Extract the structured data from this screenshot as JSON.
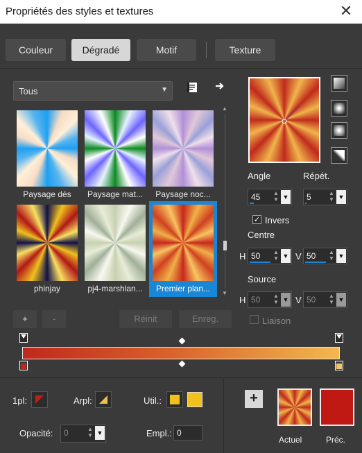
{
  "window": {
    "title": "Propriétés des styles et textures",
    "close_glyph": "✕"
  },
  "tabs": [
    {
      "label": "Couleur",
      "active": false
    },
    {
      "label": "Dégradé",
      "active": true
    },
    {
      "label": "Motif",
      "active": false
    },
    {
      "label": "Texture",
      "active": false
    }
  ],
  "category": {
    "selected": "Tous"
  },
  "icons": {
    "dropdown": "chevron-down-icon",
    "notes": "notes-icon",
    "arrow": "arrow-right-icon"
  },
  "gallery": [
    {
      "label": "Paysage dés",
      "colors": [
        "#1da0f0",
        "#f6dcc6",
        "#fff0d8",
        "#58b4f0"
      ],
      "selected": false
    },
    {
      "label": "Paysage mat...",
      "colors": [
        "#0d8a24",
        "#e6f2ff",
        "#6d64ff",
        "#ffffff"
      ],
      "selected": false
    },
    {
      "label": "Paysage noc...",
      "colors": [
        "#b090d8",
        "#e0c8d8",
        "#9aa0d8",
        "#f0e0ea"
      ],
      "selected": false
    },
    {
      "label": "phinjay",
      "colors": [
        "#12124a",
        "#f0c020",
        "#b01818",
        "#f8e060"
      ],
      "selected": false
    },
    {
      "label": "pj4-marshlan...",
      "colors": [
        "#c8d0b0",
        "#f8f8f0",
        "#a0b098",
        "#e8ecd8"
      ],
      "selected": false
    },
    {
      "label": "Premier plan...",
      "colors": [
        "#c8281c",
        "#f0b048",
        "#d04020",
        "#f7c460"
      ],
      "selected": true
    }
  ],
  "buttons": {
    "add": "+",
    "remove": "-",
    "reset": "Réinit",
    "save": "Enreg."
  },
  "preview": {
    "colors": [
      "#c02a1c",
      "#f0b44c"
    ]
  },
  "angle": {
    "label": "Angle",
    "value": "45",
    "fill": 0.125
  },
  "repeat": {
    "label": "Répét.",
    "value": "5",
    "fill": 0.05
  },
  "invert": {
    "label": "Invers",
    "checked": true
  },
  "center": {
    "label": "Centre",
    "h_label": "H",
    "h_value": "50",
    "v_label": "V",
    "v_value": "50",
    "fill": 0.5
  },
  "source": {
    "label": "Source",
    "h_label": "H",
    "h_value": "50",
    "v_label": "V",
    "v_value": "50",
    "fill": 0.5
  },
  "link": {
    "label": "Liaison",
    "checked": false
  },
  "gradient": {
    "start_color": "#c0281c",
    "end_color": "#f3c66a"
  },
  "bottom": {
    "foreground_label": "1pl:",
    "background_label": "Arpl:",
    "use_label": "Util.:",
    "opacity_label": "Opacité:",
    "opacity_value": "0",
    "location_label": "Empl.:",
    "location_value": "0",
    "use_color": "#f2c21c",
    "current_label": "Actuel",
    "previous_label": "Préc.",
    "previous_color": "#c01812",
    "plus": "+"
  }
}
